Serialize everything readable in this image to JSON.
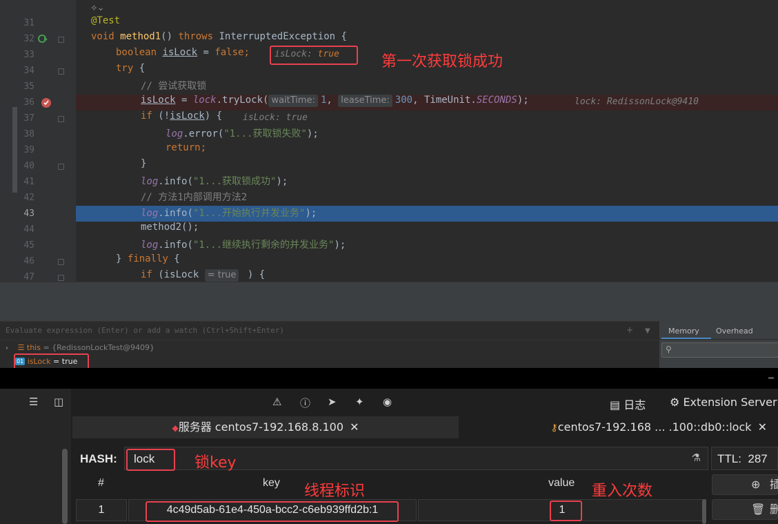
{
  "editor": {
    "line_numbers": [
      "31",
      "32",
      "33",
      "34",
      "35",
      "36",
      "37",
      "38",
      "39",
      "40",
      "41",
      "42",
      "43",
      "44",
      "45",
      "46",
      "47"
    ],
    "current_line": "43",
    "lines": {
      "l31": {
        "ann": "@Test"
      },
      "l32": {
        "kw1": "void",
        "fn": "method1",
        "p1": "() ",
        "kw2": "throws",
        "rest": " InterruptedException {"
      },
      "l33": {
        "kw1": "boolean",
        "var": "isLock",
        "rest": " = ",
        "kw2": "false",
        "semi": ";",
        "inline_name": "isLock: ",
        "inline_val": "true"
      },
      "l34": {
        "kw1": "try",
        "rest": " {"
      },
      "l35": {
        "cmt": "// 尝试获取锁"
      },
      "l36": {
        "var": "isLock",
        "p1": " = ",
        "fld": "lock",
        "p2": ".tryLock(",
        "hint1": "waitTime:",
        "num1": "1",
        "p3": ", ",
        "hint2": "leaseTime:",
        "num2": "300",
        "p4": ", TimeUnit.",
        "en": "SECONDS",
        "p5": ");",
        "inline": "lock: RedissonLock@9410"
      },
      "l37": {
        "kw1": "if",
        "p1": " (!",
        "var": "isLock",
        "p2": ") {",
        "inline": "isLock: true"
      },
      "l38": {
        "fld": "log",
        "p1": ".error(",
        "str": "\"1...获取锁失败\"",
        "p2": ");"
      },
      "l39": {
        "kw1": "return",
        "p1": ";"
      },
      "l40": {
        "p1": "}"
      },
      "l41": {
        "fld": "log",
        "p1": ".info(",
        "str": "\"1...获取锁成功\"",
        "p2": ");"
      },
      "l42": {
        "cmt": "// 方法1内部调用方法2"
      },
      "l43": {
        "fld": "log",
        "p1": ".info(",
        "str": "\"1...开始执行并发业务\"",
        "p2": ");"
      },
      "l44": {
        "p1": "method2();"
      },
      "l45": {
        "fld": "log",
        "p1": ".info(",
        "str": "\"1...继续执行剩余的并发业务\"",
        "p2": ");"
      },
      "l46": {
        "p1": "} ",
        "kw1": "finally",
        "p2": " {"
      },
      "l47": {
        "kw1": "if",
        "p1": " (isLock ",
        "hint": "= true",
        "p2": " ) {"
      }
    },
    "annotation_first_lock": "第一次获取锁成功"
  },
  "debugger": {
    "eval_placeholder": "Evaluate expression (Enter) or add a watch (Ctrl+Shift+Enter)",
    "vars": [
      {
        "name": "this",
        "value": " = {RedissonLockTest@9409}"
      },
      {
        "name": "isLock",
        "value": " = true"
      }
    ],
    "tabs": [
      "Memory",
      "Overhead"
    ]
  },
  "redis": {
    "toolbar": {
      "log_label": "日志",
      "ext_label": "Extension Server"
    },
    "tabs": [
      {
        "label": "服务器 centos7-192.168.8.100"
      },
      {
        "label": "centos7-192.168 ... .100::db0::lock"
      }
    ],
    "hash_label": "HASH:",
    "key_value": "lock",
    "key_annotation": "锁key",
    "ttl": "TTL:  287",
    "columns": {
      "index": "#",
      "key": "key",
      "value": "value"
    },
    "annotation_thread": "线程标识",
    "annotation_reentry": "重入次数",
    "rows": [
      {
        "index": "1",
        "key": "4c49d5ab-61e4-450a-bcc2-c6eb939ffd2b:1",
        "value": "1"
      }
    ],
    "buttons": {
      "insert": "插",
      "delete": "删"
    }
  },
  "colors": {
    "accent_red": "#e8414f",
    "selection": "#2d5a8f"
  }
}
